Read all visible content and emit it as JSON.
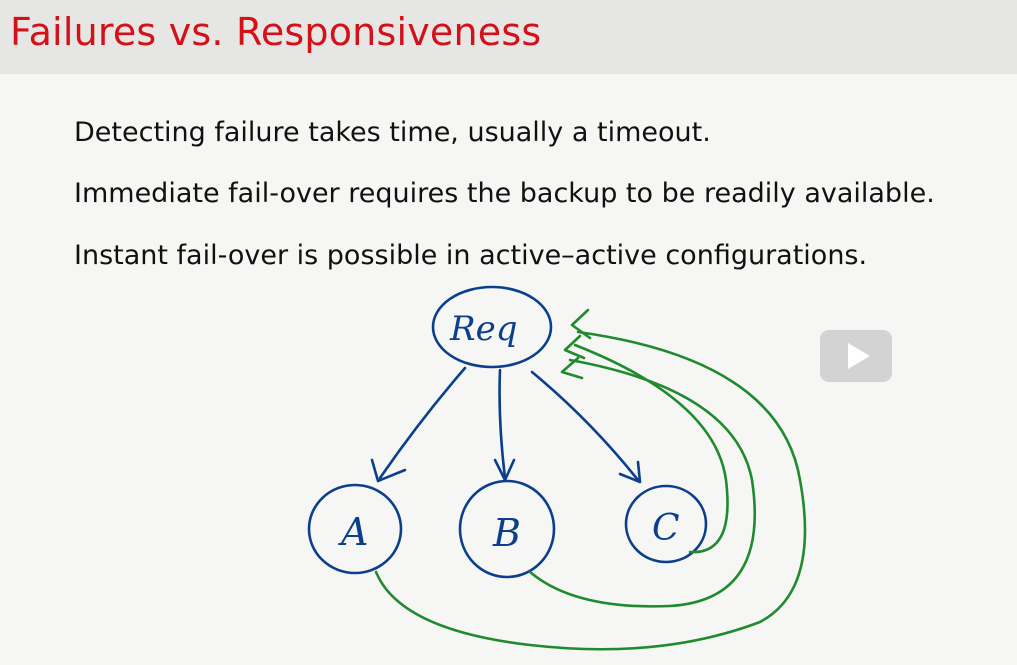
{
  "slide": {
    "title": "Failures vs. Responsiveness",
    "bullets": [
      "Detecting failure takes time, usually a timeout.",
      "Immediate fail-over requires the backup to be readily available.",
      "Instant fail-over is possible in active–active configurations."
    ]
  },
  "diagram": {
    "nodes": {
      "req": "Req",
      "a": "A",
      "b": "B",
      "c": "C"
    },
    "colors": {
      "request_edges": "#0b3f8c",
      "reply_edges": "#1f8a2e"
    }
  },
  "player": {
    "play_icon": "play-icon"
  }
}
